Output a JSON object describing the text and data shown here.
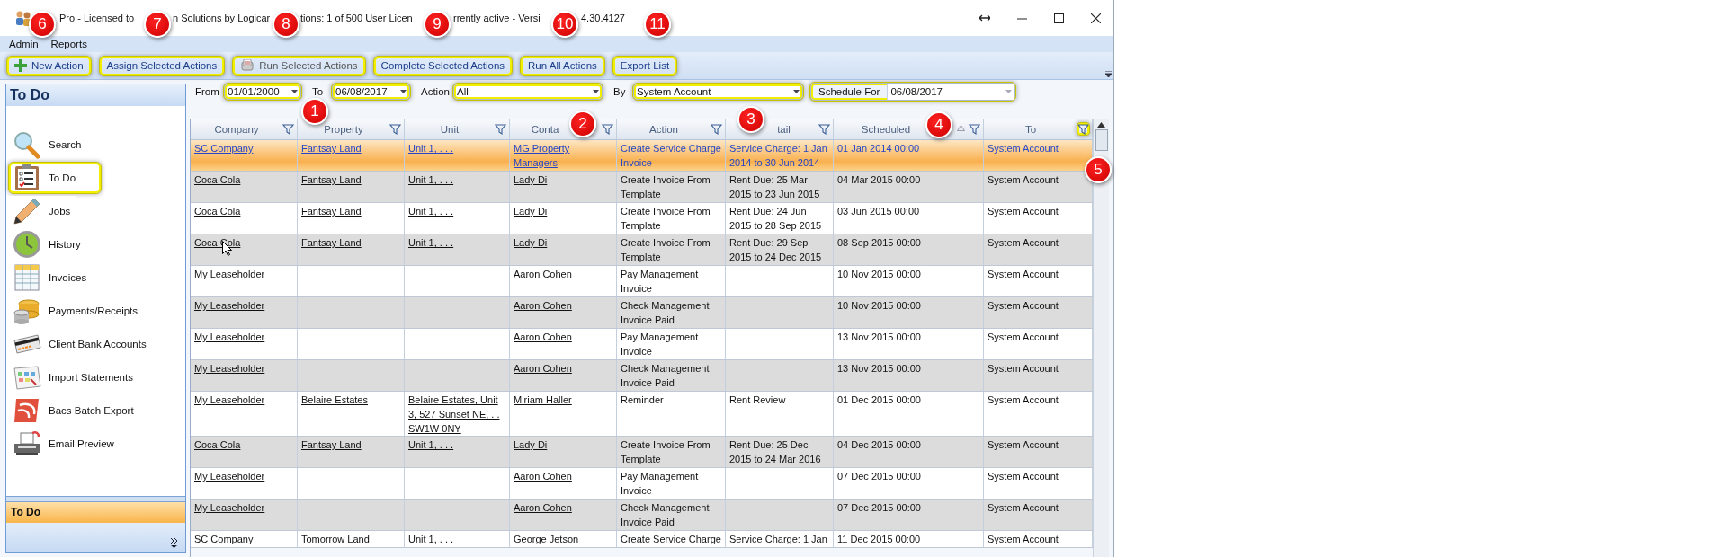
{
  "window": {
    "title_fragments": [
      "Pro - Licensed to",
      "n Solutions by Logicar",
      "tions: 1 of 500 User Licen",
      "rrently active - Versi",
      "4.30.4127"
    ]
  },
  "menu": [
    "Admin",
    "Reports"
  ],
  "toolbar": [
    {
      "label": "New Action",
      "highlighted": true
    },
    {
      "label": "Assign Selected Actions",
      "highlighted": true
    },
    {
      "label": "Run Selected Actions",
      "highlighted": true
    },
    {
      "label": "Complete Selected Actions",
      "highlighted": true
    },
    {
      "label": "Run All Actions",
      "highlighted": true
    },
    {
      "label": "Export List",
      "highlighted": true
    }
  ],
  "filters": [
    {
      "label": "From",
      "value": "01/01/2000",
      "highlighted": true
    },
    {
      "label": "To",
      "value": "06/08/2017",
      "highlighted": true
    },
    {
      "label": "Action",
      "value": "All",
      "highlighted": true
    },
    {
      "label": "By",
      "value": "System Account",
      "highlighted": true
    },
    {
      "label": "Schedule For",
      "value": "06/08/2017",
      "highlighted": true
    }
  ],
  "sidebar": {
    "title": "To Do",
    "items": [
      {
        "label": "Search",
        "highlighted": false
      },
      {
        "label": "To Do",
        "highlighted": true
      },
      {
        "label": "Jobs",
        "highlighted": false
      },
      {
        "label": "History",
        "highlighted": false
      },
      {
        "label": "Invoices",
        "highlighted": false
      },
      {
        "label": "Payments/Receipts",
        "highlighted": false
      },
      {
        "label": "Client Bank Accounts",
        "highlighted": false
      },
      {
        "label": "Import Statements",
        "highlighted": false
      },
      {
        "label": "Bacs Batch Export",
        "highlighted": false
      },
      {
        "label": "Email Preview",
        "highlighted": false
      }
    ],
    "footer": "To Do"
  },
  "table": {
    "columns": [
      {
        "label": "Company",
        "kind": "link",
        "sort_ascending": false,
        "filter_highlighted": false
      },
      {
        "label": "Property",
        "kind": "link",
        "sort_ascending": false,
        "filter_highlighted": false
      },
      {
        "label": "Unit",
        "kind": "link",
        "sort_ascending": false,
        "filter_highlighted": false
      },
      {
        "label": "Conta",
        "kind": "link",
        "sort_ascending": false,
        "filter_highlighted": false
      },
      {
        "label": "Action",
        "kind": "text",
        "sort_ascending": false,
        "filter_highlighted": false
      },
      {
        "label": "tail",
        "kind": "text",
        "sort_ascending": false,
        "filter_highlighted": false
      },
      {
        "label": "Scheduled",
        "kind": "text",
        "sort_ascending": true,
        "filter_highlighted": false
      },
      {
        "label": "To",
        "kind": "text",
        "sort_ascending": false,
        "filter_highlighted": true
      }
    ],
    "rows": [
      {
        "selected": true,
        "company": "SC Company",
        "property": "Fantsay Land",
        "unit": "Unit 1, . . .",
        "contact": "MG Property Managers",
        "action": "Create Service Charge Invoice",
        "detail": "Service Charge: 1 Jan 2014 to 30 Jun 2014",
        "scheduled": "01 Jan 2014 00:00",
        "to": "System Account"
      },
      {
        "selected": false,
        "company": "Coca Cola",
        "property": "Fantsay Land",
        "unit": "Unit 1, . . .",
        "contact": "Lady Di",
        "action": "Create Invoice From Template",
        "detail": "Rent Due: 25 Mar 2015 to 23 Jun 2015",
        "scheduled": "04 Mar 2015 00:00",
        "to": "System Account"
      },
      {
        "selected": false,
        "company": "Coca Cola",
        "property": "Fantsay Land",
        "unit": "Unit 1, . . .",
        "contact": "Lady Di",
        "action": "Create Invoice From Template",
        "detail": "Rent Due: 24 Jun 2015 to 28 Sep 2015",
        "scheduled": "03 Jun 2015 00:00",
        "to": "System Account"
      },
      {
        "selected": false,
        "company": "Coca Cola",
        "property": "Fantsay Land",
        "unit": "Unit 1, . . .",
        "contact": "Lady Di",
        "action": "Create Invoice From Template",
        "detail": "Rent Due: 29 Sep 2015 to 24 Dec 2015",
        "scheduled": "08 Sep 2015 00:00",
        "to": "System Account"
      },
      {
        "selected": false,
        "company": "My Leaseholder",
        "contact": "Aaron Cohen",
        "action": "Pay Management Invoice",
        "scheduled": "10 Nov 2015 00:00",
        "to": "System Account"
      },
      {
        "selected": false,
        "company": "My Leaseholder",
        "contact": "Aaron Cohen",
        "action": "Check Management Invoice Paid",
        "scheduled": "10 Nov 2015 00:00",
        "to": "System Account"
      },
      {
        "selected": false,
        "company": "My Leaseholder",
        "contact": "Aaron Cohen",
        "action": "Pay Management Invoice",
        "scheduled": "13 Nov 2015 00:00",
        "to": "System Account"
      },
      {
        "selected": false,
        "company": "My Leaseholder",
        "contact": "Aaron Cohen",
        "action": "Check Management Invoice Paid",
        "scheduled": "13 Nov 2015 00:00",
        "to": "System Account"
      },
      {
        "selected": false,
        "company": "My Leaseholder",
        "property": "Belaire Estates",
        "unit": "Belaire Estates, Unit 3, 527 Sunset NE, . . SW1W 0NY",
        "contact": "Miriam Haller",
        "action": "Reminder",
        "detail": "Rent Review",
        "scheduled": "01 Dec 2015 00:00",
        "to": "System Account"
      },
      {
        "selected": false,
        "company": "Coca Cola",
        "property": "Fantsay Land",
        "unit": "Unit 1, . . .",
        "contact": "Lady Di",
        "action": "Create Invoice From Template",
        "detail": "Rent Due: 25 Dec 2015 to 24 Mar 2016",
        "scheduled": "04 Dec 2015 00:00",
        "to": "System Account"
      },
      {
        "selected": false,
        "company": "My Leaseholder",
        "contact": "Aaron Cohen",
        "action": "Pay Management Invoice",
        "scheduled": "07 Dec 2015 00:00",
        "to": "System Account"
      },
      {
        "selected": false,
        "company": "My Leaseholder",
        "contact": "Aaron Cohen",
        "action": "Check Management Invoice Paid",
        "scheduled": "07 Dec 2015 00:00",
        "to": "System Account"
      },
      {
        "selected": false,
        "company": "SC Company",
        "property": "Tomorrow Land",
        "unit": "Unit 1, . . .",
        "contact": "George Jetson",
        "action": "Create Service Charge",
        "detail": "Service Charge: 1 Jan",
        "scheduled": "11 Dec 2015 00:00",
        "to": "System Account"
      }
    ]
  },
  "callouts": [
    "1",
    "2",
    "3",
    "4",
    "5",
    "6",
    "7",
    "8",
    "9",
    "10",
    "11"
  ]
}
